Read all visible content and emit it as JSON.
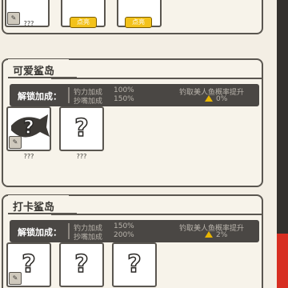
{
  "top_section": {
    "cards": [
      {
        "label": "???",
        "has_badge": true
      },
      {
        "label": "",
        "button": "点亮"
      },
      {
        "label": "",
        "button": "点亮"
      }
    ]
  },
  "island1": {
    "title": "可爱鲨岛",
    "bonus_label": "解锁加成：",
    "stat1_name": "钓力加成",
    "stat1_value": "100%",
    "stat2_name": "抄嘴加成",
    "stat2_value": "150%",
    "extra_text": "钓取美人鱼概率提升",
    "extra_percent": "0%",
    "cards": [
      {
        "label": "???",
        "has_badge": true,
        "has_fish": true
      },
      {
        "label": "???",
        "q": "?"
      }
    ]
  },
  "island2": {
    "title": "打卡鲨岛",
    "bonus_label": "解锁加成：",
    "stat1_name": "钓力加成",
    "stat1_value": "150%",
    "stat2_name": "抄嘴加成",
    "stat2_value": "200%",
    "extra_text": "钓取美人鱼概率提升",
    "extra_percent": "2%",
    "cards": [
      {
        "q": "?",
        "has_badge": true
      },
      {
        "q": "?"
      },
      {
        "q": "?"
      }
    ]
  },
  "colors": {
    "accent": "#f3c21a",
    "panel_border": "#5a5650",
    "bonus_bg": "#4a4744",
    "sidebar_red": "#d72e22"
  }
}
